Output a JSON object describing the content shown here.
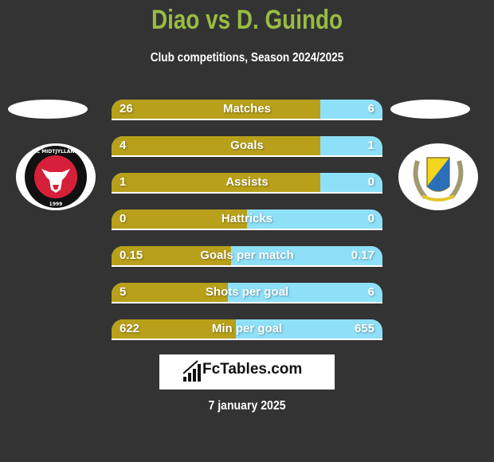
{
  "header": {
    "title": "Diao vs D. Guindo",
    "subtitle": "Club competitions, Season 2024/2025"
  },
  "colors": {
    "background": "#333333",
    "title": "#99bb44",
    "left_bar": "#b8a01a",
    "right_bar": "#8ee0f8"
  },
  "teams": {
    "left": {
      "logo_icon": "fc-midtjylland-crest-icon",
      "logo_text_top": "FC MIDTJYLLAND",
      "logo_text_bottom": "1999"
    },
    "right": {
      "logo_icon": "laurel-shield-crest-icon"
    }
  },
  "stats": [
    {
      "label": "Matches",
      "left": "26",
      "right": "6",
      "left_share": 0.77
    },
    {
      "label": "Goals",
      "left": "4",
      "right": "1",
      "left_share": 0.77
    },
    {
      "label": "Assists",
      "left": "1",
      "right": "0",
      "left_share": 0.77
    },
    {
      "label": "Hattricks",
      "left": "0",
      "right": "0",
      "left_share": 0.5
    },
    {
      "label": "Goals per match",
      "left": "0.15",
      "right": "0.17",
      "left_share": 0.44
    },
    {
      "label": "Shots per goal",
      "left": "5",
      "right": "6",
      "left_share": 0.43
    },
    {
      "label": "Min per goal",
      "left": "622",
      "right": "655",
      "left_share": 0.46
    }
  ],
  "footer": {
    "brand": "FcTables.com",
    "date": "7 january 2025"
  }
}
